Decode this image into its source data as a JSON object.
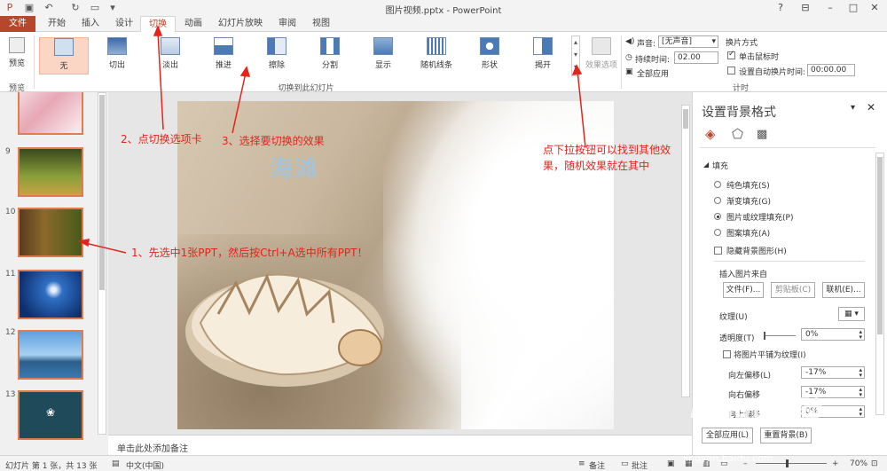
{
  "window": {
    "title": "图片视频.pptx - PowerPoint"
  },
  "tabs": [
    "文件",
    "开始",
    "插入",
    "设计",
    "切换",
    "动画",
    "幻灯片放映",
    "审阅",
    "视图"
  ],
  "ribbon": {
    "preview": {
      "button": "预览",
      "group": "预览"
    },
    "transitions": [
      {
        "label": "无",
        "selected": true
      },
      {
        "label": "切出"
      },
      {
        "label": "淡出"
      },
      {
        "label": "推进"
      },
      {
        "label": "擦除"
      },
      {
        "label": "分割"
      },
      {
        "label": "显示"
      },
      {
        "label": "随机线条"
      },
      {
        "label": "形状"
      },
      {
        "label": "揭开"
      }
    ],
    "transitions_group": "切换到此幻灯片",
    "effect_options": "效果选项",
    "timing": {
      "sound_label": "声音:",
      "sound_value": "[无声音]",
      "duration_label": "持续时间:",
      "duration_value": "02.00",
      "apply_all": "全部应用",
      "advance_title": "换片方式",
      "on_click": "单击鼠标时",
      "after_time": "设置自动换片时间:",
      "after_time_value": "00:00.00",
      "group": "计时"
    }
  },
  "thumbnails": {
    "numbers": [
      "9",
      "10",
      "11",
      "12",
      "13"
    ]
  },
  "slide": {
    "title": "海滩"
  },
  "notes": {
    "placeholder": "单击此处添加备注"
  },
  "pane": {
    "title": "设置背景格式",
    "section": "填充",
    "options": [
      {
        "label": "纯色填充(S)",
        "checked": false
      },
      {
        "label": "渐变填充(G)",
        "checked": false
      },
      {
        "label": "图片或纹理填充(P)",
        "checked": true
      },
      {
        "label": "图案填充(A)",
        "checked": false
      }
    ],
    "hide_bg": "隐藏背景图形(H)",
    "insert_from": "插入图片来自",
    "file_btn": "文件(F)...",
    "clipboard_btn": "剪贴板(C)",
    "online_btn": "联机(E)...",
    "texture_label": "纹理(U)",
    "transparency_label": "透明度(T)",
    "transparency_value": "0%",
    "tile_label": "将图片平铺为纹理(I)",
    "offset_left_label": "向左偏移(L)",
    "offset_left_value": "-17%",
    "offset_right_label": "向右偏移",
    "offset_right_value": "-17%",
    "offset_top_label": "向上偏移",
    "offset_top_value": "0%",
    "apply_all_btn": "全部应用(L)",
    "reset_btn": "重置背景(B)"
  },
  "status": {
    "slide_info": "幻灯片 第 1 张，共 13 张",
    "language": "中文(中国)",
    "notes": "备注",
    "comments": "批注",
    "zoom": "70%"
  },
  "annotations": {
    "step1": "1、先选中1张PPT，然后按Ctrl+A选中所有PPT！",
    "step2": "2、点切换选项卡",
    "step3": "3、选择要切换的效果",
    "dropdown_note": "点下拉按钮可以找到其他效果，随机效果就在其中"
  },
  "watermark": {
    "brand": "Baidu经验",
    "url": "jingyan.baidu.com"
  },
  "colors": {
    "accent": "#b7472a",
    "annotation": "#e5231b",
    "selected_transition": "#fcd6c5"
  }
}
